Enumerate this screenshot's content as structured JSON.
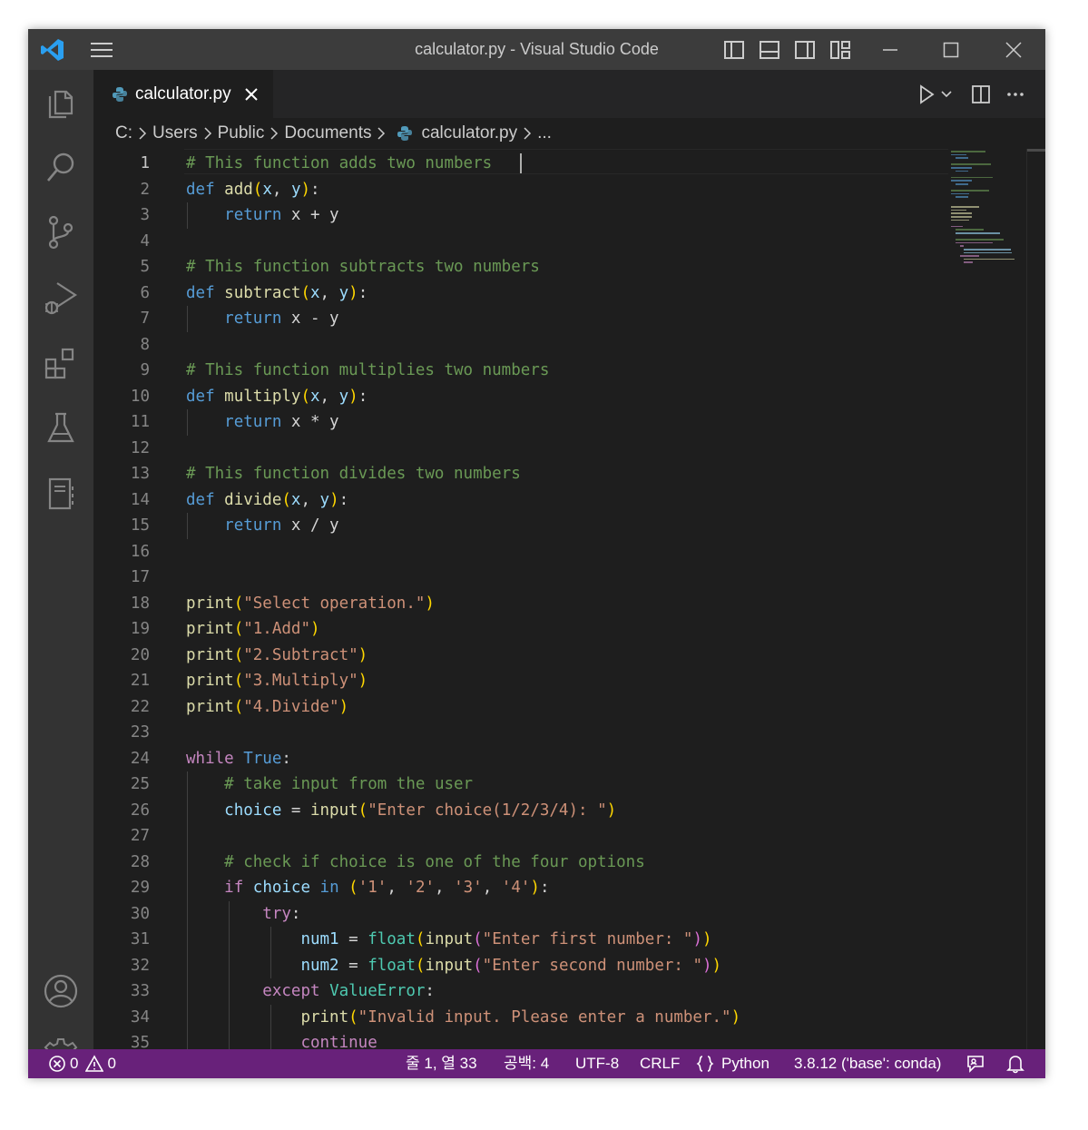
{
  "window": {
    "title": "calculator.py - Visual Studio Code"
  },
  "titlebar": {
    "icons": [
      "vscode-logo-icon",
      "menu-icon",
      "toggle-primary-sidebar-icon",
      "toggle-panel-icon",
      "toggle-secondary-sidebar-icon",
      "customize-layout-icon"
    ],
    "controls": [
      "minimize-icon",
      "maximize-icon",
      "close-icon"
    ]
  },
  "activity_bar": {
    "top": [
      "explorer-icon",
      "search-icon",
      "source-control-icon",
      "run-debug-icon",
      "extensions-icon",
      "testing-icon",
      "notebook-icon"
    ],
    "bottom": [
      "accounts-icon",
      "settings-gear-icon"
    ]
  },
  "tab": {
    "label": "calculator.py",
    "icon": "python-icon",
    "close_icon": "close-icon"
  },
  "tab_actions": [
    "run-icon",
    "chevron-down-icon",
    "split-editor-icon",
    "more-actions-icon"
  ],
  "breadcrumb": [
    "C:",
    "Users",
    "Public",
    "Documents",
    "calculator.py",
    "..."
  ],
  "editor": {
    "active_line": 1,
    "lines": [
      [
        [
          "c",
          "# This function adds two numbers"
        ]
      ],
      [
        [
          "k",
          "def"
        ],
        [
          "",
          "​ "
        ],
        [
          "f",
          "add"
        ],
        [
          "p1",
          "("
        ],
        [
          "v",
          "x"
        ],
        [
          "",
          ", "
        ],
        [
          "v",
          "y"
        ],
        [
          "p1",
          ")"
        ],
        [
          "",
          ":"
        ]
      ],
      [
        [
          "",
          "    "
        ],
        [
          "k",
          "return"
        ],
        [
          "",
          " x + y"
        ]
      ],
      [],
      [
        [
          "c",
          "# This function subtracts two numbers"
        ]
      ],
      [
        [
          "k",
          "def"
        ],
        [
          "",
          " "
        ],
        [
          "f",
          "subtract"
        ],
        [
          "p1",
          "("
        ],
        [
          "v",
          "x"
        ],
        [
          "",
          ", "
        ],
        [
          "v",
          "y"
        ],
        [
          "p1",
          ")"
        ],
        [
          "",
          ":"
        ]
      ],
      [
        [
          "",
          "    "
        ],
        [
          "k",
          "return"
        ],
        [
          "",
          " x - y"
        ]
      ],
      [],
      [
        [
          "c",
          "# This function multiplies two numbers"
        ]
      ],
      [
        [
          "k",
          "def"
        ],
        [
          "",
          " "
        ],
        [
          "f",
          "multiply"
        ],
        [
          "p1",
          "("
        ],
        [
          "v",
          "x"
        ],
        [
          "",
          ", "
        ],
        [
          "v",
          "y"
        ],
        [
          "p1",
          ")"
        ],
        [
          "",
          ":"
        ]
      ],
      [
        [
          "",
          "    "
        ],
        [
          "k",
          "return"
        ],
        [
          "",
          " x * y"
        ]
      ],
      [],
      [
        [
          "c",
          "# This function divides two numbers"
        ]
      ],
      [
        [
          "k",
          "def"
        ],
        [
          "",
          " "
        ],
        [
          "f",
          "divide"
        ],
        [
          "p1",
          "("
        ],
        [
          "v",
          "x"
        ],
        [
          "",
          ", "
        ],
        [
          "v",
          "y"
        ],
        [
          "p1",
          ")"
        ],
        [
          "",
          ":"
        ]
      ],
      [
        [
          "",
          "    "
        ],
        [
          "k",
          "return"
        ],
        [
          "",
          " x / y"
        ]
      ],
      [],
      [],
      [
        [
          "f",
          "print"
        ],
        [
          "p1",
          "("
        ],
        [
          "s",
          "\"Select operation.\""
        ],
        [
          "p1",
          ")"
        ]
      ],
      [
        [
          "f",
          "print"
        ],
        [
          "p1",
          "("
        ],
        [
          "s",
          "\"1.Add\""
        ],
        [
          "p1",
          ")"
        ]
      ],
      [
        [
          "f",
          "print"
        ],
        [
          "p1",
          "("
        ],
        [
          "s",
          "\"2.Subtract\""
        ],
        [
          "p1",
          ")"
        ]
      ],
      [
        [
          "f",
          "print"
        ],
        [
          "p1",
          "("
        ],
        [
          "s",
          "\"3.Multiply\""
        ],
        [
          "p1",
          ")"
        ]
      ],
      [
        [
          "f",
          "print"
        ],
        [
          "p1",
          "("
        ],
        [
          "s",
          "\"4.Divide\""
        ],
        [
          "p1",
          ")"
        ]
      ],
      [],
      [
        [
          "cf",
          "while"
        ],
        [
          "",
          " "
        ],
        [
          "k",
          "True"
        ],
        [
          "",
          ":"
        ]
      ],
      [
        [
          "",
          "    "
        ],
        [
          "c",
          "# take input from the user"
        ]
      ],
      [
        [
          "",
          "    "
        ],
        [
          "v",
          "choice"
        ],
        [
          "",
          " = "
        ],
        [
          "f",
          "input"
        ],
        [
          "p1",
          "("
        ],
        [
          "s",
          "\"Enter choice(1/2/3/4): \""
        ],
        [
          "p1",
          ")"
        ]
      ],
      [],
      [
        [
          "",
          "    "
        ],
        [
          "c",
          "# check if choice is one of the four options"
        ]
      ],
      [
        [
          "",
          "    "
        ],
        [
          "cf",
          "if"
        ],
        [
          "",
          " "
        ],
        [
          "v",
          "choice"
        ],
        [
          "",
          " "
        ],
        [
          "k",
          "in"
        ],
        [
          "",
          " "
        ],
        [
          "p1",
          "("
        ],
        [
          "s",
          "'1'"
        ],
        [
          "",
          ", "
        ],
        [
          "s",
          "'2'"
        ],
        [
          "",
          ", "
        ],
        [
          "s",
          "'3'"
        ],
        [
          "",
          ", "
        ],
        [
          "s",
          "'4'"
        ],
        [
          "p1",
          ")"
        ],
        [
          "",
          ":"
        ]
      ],
      [
        [
          "",
          "        "
        ],
        [
          "cf",
          "try"
        ],
        [
          "",
          ":"
        ]
      ],
      [
        [
          "",
          "            "
        ],
        [
          "v",
          "num1"
        ],
        [
          "",
          " = "
        ],
        [
          "cl",
          "float"
        ],
        [
          "p1",
          "("
        ],
        [
          "f",
          "input"
        ],
        [
          "p2",
          "("
        ],
        [
          "s",
          "\"Enter first number: \""
        ],
        [
          "p2",
          ")"
        ],
        [
          "p1",
          ")"
        ]
      ],
      [
        [
          "",
          "            "
        ],
        [
          "v",
          "num2"
        ],
        [
          "",
          " = "
        ],
        [
          "cl",
          "float"
        ],
        [
          "p1",
          "("
        ],
        [
          "f",
          "input"
        ],
        [
          "p2",
          "("
        ],
        [
          "s",
          "\"Enter second number: \""
        ],
        [
          "p2",
          ")"
        ],
        [
          "p1",
          ")"
        ]
      ],
      [
        [
          "",
          "        "
        ],
        [
          "cf",
          "except"
        ],
        [
          "",
          " "
        ],
        [
          "cl",
          "ValueError"
        ],
        [
          "",
          ":"
        ]
      ],
      [
        [
          "",
          "            "
        ],
        [
          "f",
          "print"
        ],
        [
          "p1",
          "("
        ],
        [
          "s",
          "\"Invalid input. Please enter a number.\""
        ],
        [
          "p1",
          ")"
        ]
      ],
      [
        [
          "",
          "            "
        ],
        [
          "cf",
          "continue"
        ]
      ]
    ]
  },
  "statusbar": {
    "errors": "0",
    "warnings": "0",
    "position": "줄 1, 열 33",
    "indent": "공백: 4",
    "encoding": "UTF-8",
    "eol": "CRLF",
    "language": "Python",
    "interpreter": "3.8.12 ('base': conda)",
    "icons": [
      "error-icon",
      "warning-icon",
      "braces-icon",
      "feedback-icon",
      "notification-bell-icon"
    ]
  }
}
